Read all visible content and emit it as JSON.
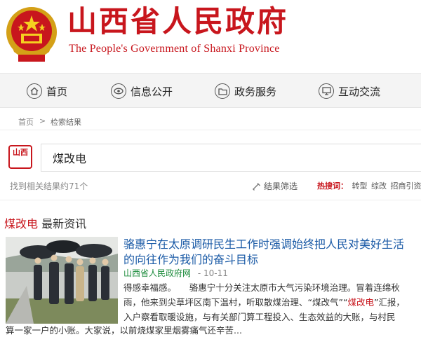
{
  "header": {
    "title": "山西省人民政府",
    "subtitle": "The People's Government of Shanxi Province"
  },
  "nav": {
    "items": [
      {
        "label": "首页",
        "icon": "home-icon"
      },
      {
        "label": "信息公开",
        "icon": "eye-icon"
      },
      {
        "label": "政务服务",
        "icon": "folder-icon"
      },
      {
        "label": "互动交流",
        "icon": "monitor-icon"
      }
    ]
  },
  "breadcrumb": {
    "home": "首页",
    "separator": ">",
    "current": "检索结果"
  },
  "search": {
    "logo_text": "山西",
    "query": "煤改电"
  },
  "results": {
    "count_text": "找到相关结果约71个",
    "filter_label": "结果筛选",
    "hot_label": "热搜词：",
    "hot_words": [
      "转型",
      "综改",
      "招商引资"
    ]
  },
  "section": {
    "keyword": "煤改电",
    "title_rest": " 最新资讯"
  },
  "news": {
    "title": "骆惠宁在太原调研民生工作时强调始终把人民对美好生活的向往作为我们的奋斗目标",
    "source": "山西省人民政府网",
    "date": "- 10-11",
    "snippet_before": "得感幸福感。　　骆惠宁十分关注太原市大气污染环境治理。冒着连绵秋雨，他来到尖草坪区南下温村，听取散煤治理、“煤改气”“",
    "snippet_highlight": "煤改电",
    "snippet_after": "”汇报，入户察看取暖设施，与有关部门算工程投入、生态效益的大账，与村民",
    "snippet_line2": "算一家一户的小账。大家说，以前烧煤家里烟雾痛气还辛苦..."
  },
  "colors": {
    "brand_red": "#c8161d",
    "link_blue": "#1a5aa6",
    "source_green": "#1a8a3a"
  }
}
